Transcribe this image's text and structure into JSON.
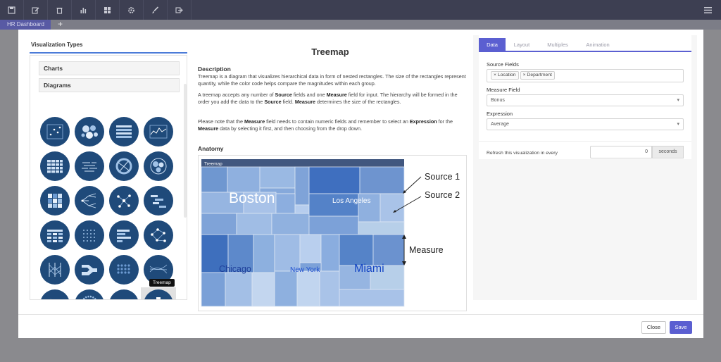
{
  "toolbar": {
    "icons": [
      "save-icon",
      "edit-icon",
      "trash-icon",
      "bar-chart-icon",
      "dashboard-icon",
      "gear-icon",
      "brush-icon",
      "export-icon"
    ],
    "menu_icon": "hamburger-icon"
  },
  "tabbar": {
    "active_tab": "HR Dashboard",
    "add_label": "+"
  },
  "left_panel": {
    "title": "Visualization Types",
    "sections": [
      "Charts",
      "Diagrams"
    ],
    "icons": [
      "scatter-grid-icon",
      "bubble-cluster-icon",
      "bar-list-icon",
      "line-chart-icon",
      "table-grid-icon",
      "word-cloud-icon",
      "chord-icon",
      "circle-pack-icon",
      "matrix-icon",
      "tree-icon",
      "network-icon",
      "gantt-icon",
      "heatmap-table-icon",
      "dot-matrix-icon",
      "horizontal-bars-icon",
      "node-graph-icon",
      "parallel-coordinates-icon",
      "sankey-icon",
      "dot-grid-icon",
      "stream-lines-icon",
      "wave-icon",
      "radial-icon",
      "dot-scatter-icon",
      "treemap-hierarchy-icon"
    ],
    "tooltip": "Treemap"
  },
  "center": {
    "title": "Treemap",
    "description_heading": "Description",
    "p1": "Treemap is a diagram that visualizes hierarchical data in form of nested rectangles. The size of the rectangles represent quantity, while the color code helps compare the magnitudes within each group.",
    "p2_a": "A treemap accepts any number of ",
    "p2_source": "Source",
    "p2_b": " fields and one ",
    "p2_measure": "Measure",
    "p2_c": " field for input. The hierarchy will be formed in the order you add the data to the ",
    "p2_source2": "Source",
    "p2_d": " field. ",
    "p2_measure2": "Measure",
    "p2_e": " determines the size of the rectangles.",
    "p3_a": "Please note that the ",
    "p3_measure": "Measure",
    "p3_b": " field needs to contain numeric fields and remember to select an ",
    "p3_expression": "Expression",
    "p3_c": " for the ",
    "p3_measure2": "Measure",
    "p3_d": " data by selecting it first, and then choosing from the drop down.",
    "anatomy_heading": "Anatomy",
    "anatomy": {
      "header": "Treemap",
      "labels": {
        "boston": "Boston",
        "los_angeles": "Los Angeles",
        "chicago": "Chicago",
        "new_york": "New York",
        "miami": "Miami"
      },
      "callouts": {
        "source1": "Source 1",
        "source2": "Source 2",
        "measure": "Measure"
      }
    }
  },
  "right_panel": {
    "tabs": [
      "Data",
      "Layout",
      "Multiples",
      "Animation"
    ],
    "active_tab": "Data",
    "source_fields_label": "Source Fields",
    "source_chips": [
      "× Location",
      "× Department"
    ],
    "measure_field_label": "Measure Field",
    "measure_value": "Bonus",
    "expression_label": "Expression",
    "expression_value": "Average",
    "refresh_label": "Refresh this visualization in every",
    "refresh_value": "0",
    "refresh_unit": "seconds"
  },
  "footer": {
    "close_label": "Close",
    "save_label": "Save"
  },
  "colors": {
    "toolbar_bg": "#3d3f52",
    "accent": "#5b5fd1",
    "icon_bg": "#1f4a7a",
    "treemap_dark": "#3f72c4",
    "treemap_light": "#b7cfe9"
  }
}
